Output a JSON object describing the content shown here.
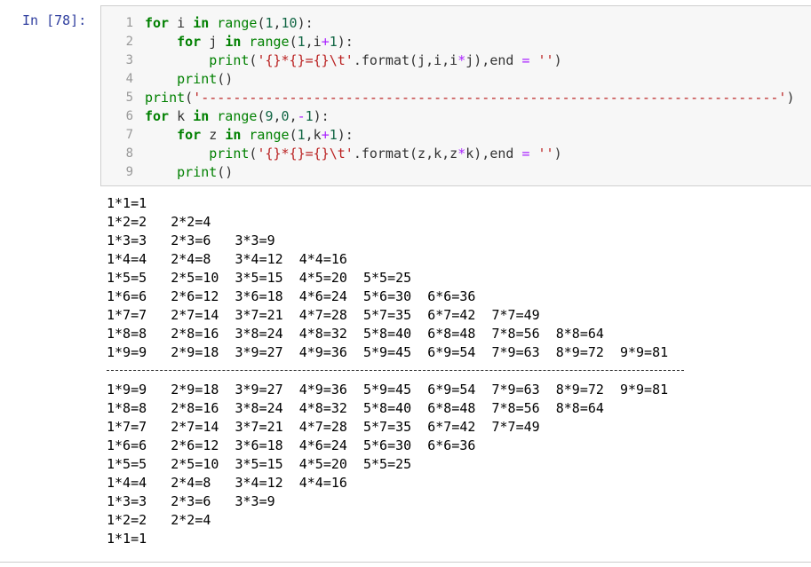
{
  "cell": {
    "prompt": "In  [78]:",
    "line_numbers": [
      "1",
      "2",
      "3",
      "4",
      "5",
      "6",
      "7",
      "8",
      "9"
    ],
    "code_lines": [
      "for i in range(1,10):",
      "    for j in range(1,i+1):",
      "        print('{}*{}={}\\t'.format(j,i,i*j),end = '')",
      "    print()",
      "print('------------------------------------------------------------------------')",
      "for k in range(9,0,-1):",
      "    for z in range(1,k+1):",
      "        print('{}*{}={}\\t'.format(z,k,z*k),end = '')",
      "    print()"
    ]
  },
  "output": {
    "upper": [
      "1*1=1",
      "1*2=2   2*2=4",
      "1*3=3   2*3=6   3*3=9",
      "1*4=4   2*4=8   3*4=12  4*4=16",
      "1*5=5   2*5=10  3*5=15  4*5=20  5*5=25",
      "1*6=6   2*6=12  3*6=18  4*6=24  5*6=30  6*6=36",
      "1*7=7   2*7=14  3*7=21  4*7=28  5*7=35  6*7=42  7*7=49",
      "1*8=8   2*8=16  3*8=24  4*8=32  5*8=40  6*8=48  7*8=56  8*8=64",
      "1*9=9   2*9=18  3*9=27  4*9=36  5*9=45  6*9=54  7*9=63  8*9=72  9*9=81"
    ],
    "lower": [
      "1*9=9   2*9=18  3*9=27  4*9=36  5*9=45  6*9=54  7*9=63  8*9=72  9*9=81",
      "1*8=8   2*8=16  3*8=24  4*8=32  5*8=40  6*8=48  7*8=56  8*8=64",
      "1*7=7   2*7=14  3*7=21  4*7=28  5*7=35  6*7=42  7*7=49",
      "1*6=6   2*6=12  3*6=18  4*6=24  5*6=30  6*6=36",
      "1*5=5   2*5=10  3*5=15  4*5=20  5*5=25",
      "1*4=4   2*4=8   3*4=12  4*4=16",
      "1*3=3   2*3=6   3*3=9",
      "1*2=2   2*2=4",
      "1*1=1"
    ]
  },
  "colors": {
    "prompt": "#303f9f",
    "keyword": "#008000",
    "string": "#ba2121",
    "number": "#116644"
  }
}
